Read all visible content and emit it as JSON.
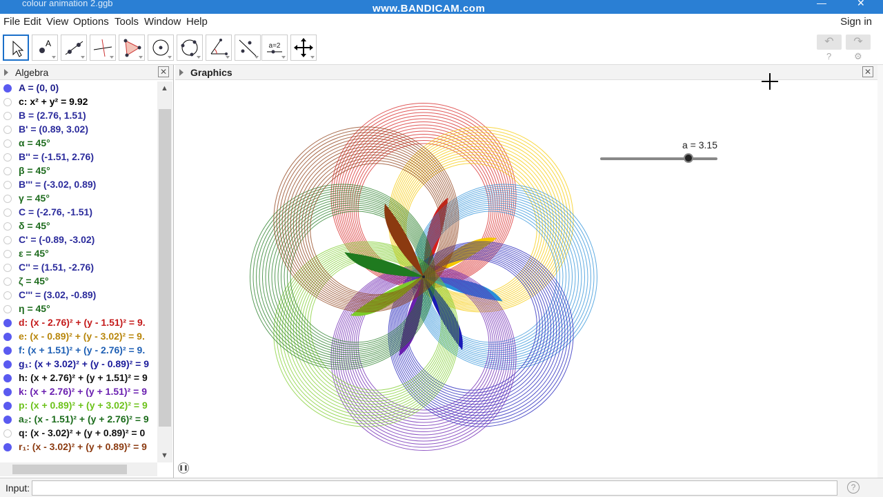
{
  "window": {
    "title": "colour animation 2.ggb",
    "watermark": "www.BANDICAM.com",
    "minimize": "—",
    "close": "✕"
  },
  "menu": {
    "items": [
      "File",
      "Edit",
      "View",
      "Options",
      "Tools",
      "Window",
      "Help"
    ],
    "sign_in": "Sign in"
  },
  "toolbar": {
    "tools": [
      "move-tool",
      "point-tool",
      "line-tool",
      "perpendicular-tool",
      "polygon-tool",
      "circle-center-tool",
      "circle-three-points-tool",
      "angle-tool",
      "reflect-tool",
      "slider-tool",
      "move-view-tool"
    ],
    "slider_tool_label": "a=2",
    "undo": "↶",
    "redo": "↷",
    "help": "?",
    "settings": "⚙"
  },
  "algebra": {
    "title": "Algebra",
    "close": "✕",
    "rows": [
      {
        "text": "A = (0, 0)",
        "color": "#1e1e8c",
        "shown": true
      },
      {
        "text": "c: x² + y² = 9.92",
        "color": "#000000",
        "shown": false
      },
      {
        "text": "B = (2.76, 1.51)",
        "color": "#2b2b9c",
        "shown": false
      },
      {
        "text": "B' = (0.89, 3.02)",
        "color": "#2b2b9c",
        "shown": false
      },
      {
        "text": "α = 45°",
        "color": "#1d6b1d",
        "shown": false
      },
      {
        "text": "B'' = (-1.51, 2.76)",
        "color": "#2b2b9c",
        "shown": false
      },
      {
        "text": "β = 45°",
        "color": "#1d6b1d",
        "shown": false
      },
      {
        "text": "B''' = (-3.02, 0.89)",
        "color": "#2b2b9c",
        "shown": false
      },
      {
        "text": "γ = 45°",
        "color": "#1d6b1d",
        "shown": false
      },
      {
        "text": "C = (-2.76, -1.51)",
        "color": "#2b2b9c",
        "shown": false
      },
      {
        "text": "δ = 45°",
        "color": "#1d6b1d",
        "shown": false
      },
      {
        "text": "C' = (-0.89, -3.02)",
        "color": "#2b2b9c",
        "shown": false
      },
      {
        "text": "ε = 45°",
        "color": "#1d6b1d",
        "shown": false
      },
      {
        "text": "C'' = (1.51, -2.76)",
        "color": "#2b2b9c",
        "shown": false
      },
      {
        "text": "ζ = 45°",
        "color": "#1d6b1d",
        "shown": false
      },
      {
        "text": "C''' = (3.02, -0.89)",
        "color": "#2b2b9c",
        "shown": false
      },
      {
        "text": "η = 45°",
        "color": "#1d6b1d",
        "shown": false
      },
      {
        "text": "d: (x - 2.76)² + (y - 1.51)² = 9.",
        "color": "#c41a1a",
        "shown": true
      },
      {
        "text": "e: (x - 0.89)² + (y - 3.02)² = 9.",
        "color": "#b8860b",
        "shown": true
      },
      {
        "text": "f: (x + 1.51)² + (y - 2.76)² = 9.",
        "color": "#1e5fb4",
        "shown": true
      },
      {
        "text": "g₁: (x + 3.02)² + (y - 0.89)² = 9",
        "color": "#1a1a9a",
        "shown": true
      },
      {
        "text": "h: (x + 2.76)² + (y + 1.51)² = 9",
        "color": "#111111",
        "shown": true
      },
      {
        "text": "k: (x + 2.76)² + (y + 1.51)² = 9",
        "color": "#6a1fb0",
        "shown": true
      },
      {
        "text": "p: (x + 0.89)² + (y + 3.02)² = 9",
        "color": "#6cc21a",
        "shown": true
      },
      {
        "text": "a₂: (x - 1.51)² + (y + 2.76)² = 9",
        "color": "#1a6b1a",
        "shown": true
      },
      {
        "text": "q: (x - 3.02)² + (y + 0.89)² = 0",
        "color": "#111111",
        "shown": false
      },
      {
        "text": "r₁: (x - 3.02)² + (y + 0.89)² = 9",
        "color": "#8b3a10",
        "shown": true
      }
    ]
  },
  "graphics": {
    "title": "Graphics",
    "close": "✕",
    "slider_label": "a = 3.15",
    "slider_fraction": 0.75,
    "flower_colors": [
      "#d62020",
      "#f5c800",
      "#2a8fd8",
      "#1a1ab8",
      "#6a1fb0",
      "#7ccc2a",
      "#1f7a1f",
      "#8b3a10"
    ]
  },
  "input": {
    "label": "Input:",
    "value": "",
    "help": "?"
  }
}
